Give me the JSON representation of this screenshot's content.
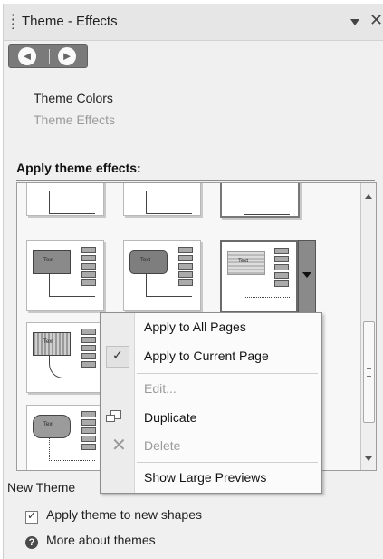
{
  "window": {
    "title": "Theme - Effects",
    "menu_icon": "caret-down-icon",
    "close_glyph": "✕"
  },
  "nav": {
    "back_glyph": "◄",
    "forward_glyph": "►"
  },
  "links": {
    "theme_colors": "Theme Colors",
    "theme_effects": "Theme Effects"
  },
  "section": {
    "heading": "Apply theme effects:"
  },
  "gallery": {
    "thumb_text": "Text",
    "selected_index": 5
  },
  "context_menu": {
    "items": [
      {
        "label": "Apply to All Pages",
        "enabled": true,
        "checked": false
      },
      {
        "label": "Apply to Current Page",
        "enabled": true,
        "checked": true
      },
      {
        "label": "Edit...",
        "enabled": false,
        "checked": false
      },
      {
        "label": "Duplicate",
        "enabled": true,
        "checked": false,
        "icon": "duplicate-icon"
      },
      {
        "label": "Delete",
        "enabled": false,
        "checked": false,
        "icon": "delete-icon"
      },
      {
        "label": "Show Large Previews",
        "enabled": true,
        "checked": false
      }
    ]
  },
  "footer": {
    "new_theme_label": "New Theme",
    "apply_new_shapes_label": "Apply theme to new shapes",
    "apply_new_shapes_checked": true,
    "more_about_label": "More about themes"
  },
  "colors": {
    "link_active": "#222222",
    "link_disabled": "#9a9a9a"
  }
}
